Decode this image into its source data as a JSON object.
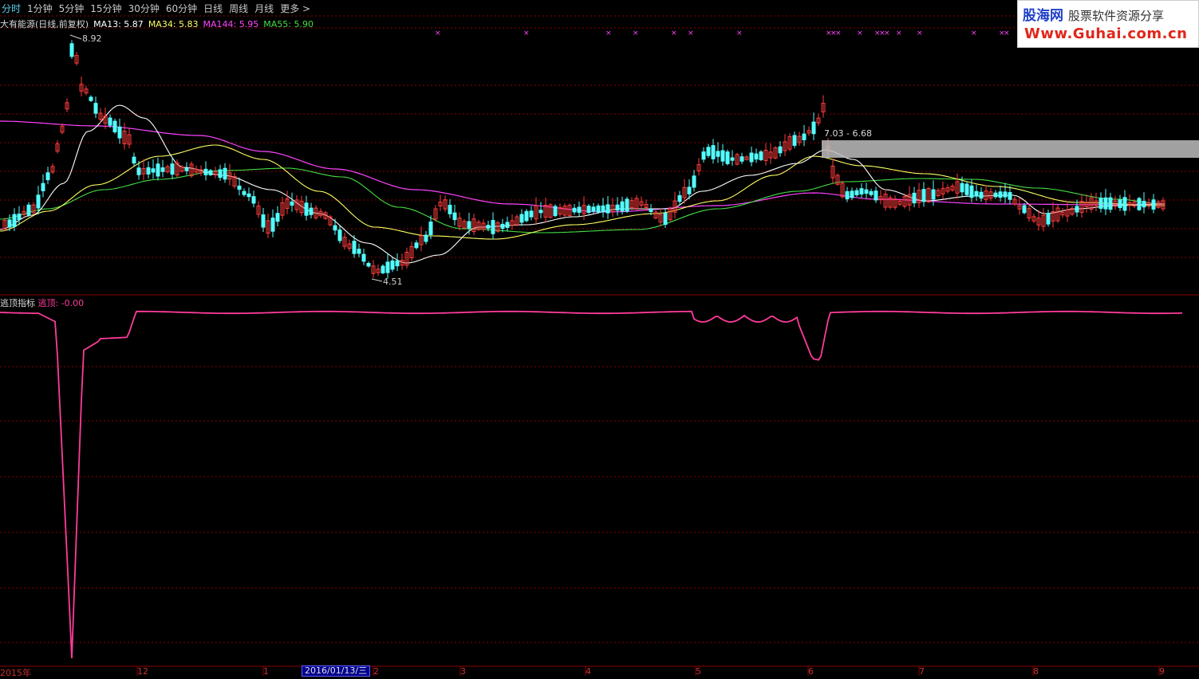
{
  "toolbar": {
    "items": [
      "分时",
      "1分钟",
      "5分钟",
      "15分钟",
      "30分钟",
      "60分钟",
      "日线",
      "周线",
      "月线",
      "更多 >"
    ],
    "active_index": 0
  },
  "legend": {
    "stock_label": "大有能源(日线,前复权)",
    "ma13": "MA13: 5.87",
    "ma34": "MA34: 5.83",
    "ma144": "MA144: 5.95",
    "ma55": "MA55: 5.90"
  },
  "watermark": {
    "brand": "股海网",
    "subtitle": "股票软件资源分享",
    "url": "Www.Guhai.com.cn"
  },
  "annotations": {
    "high": "8.92",
    "low": "4.51",
    "range": "7.03 - 6.68"
  },
  "indicator": {
    "name": "逃顶指标",
    "series_label": "逃顶: -0.00"
  },
  "x_axis": {
    "labels": [
      "2015年",
      "12",
      "1",
      "2",
      "3",
      "4",
      "5",
      "6",
      "7",
      "8",
      "9"
    ],
    "cursor_date": "2016/01/13/三"
  },
  "colors": {
    "up": "#ff3c3c",
    "down": "#54ffff",
    "ma13": "#ffffff",
    "ma34": "#ffff64",
    "ma144": "#ff44ff",
    "ma55": "#44dd44",
    "indicator": "#ff3c9a",
    "grid": "#8c0000"
  },
  "chart_data": {
    "type": "candlestick",
    "x": [
      "2015年",
      "12",
      "1",
      "2",
      "3",
      "4",
      "5",
      "6",
      "7",
      "8",
      "9"
    ],
    "price_high_label": 8.92,
    "price_low_label": 4.51,
    "ma_values": {
      "MA13": 5.87,
      "MA34": 5.83,
      "MA144": 5.95,
      "MA55": 5.9
    },
    "indicator_value": -0.0
  }
}
